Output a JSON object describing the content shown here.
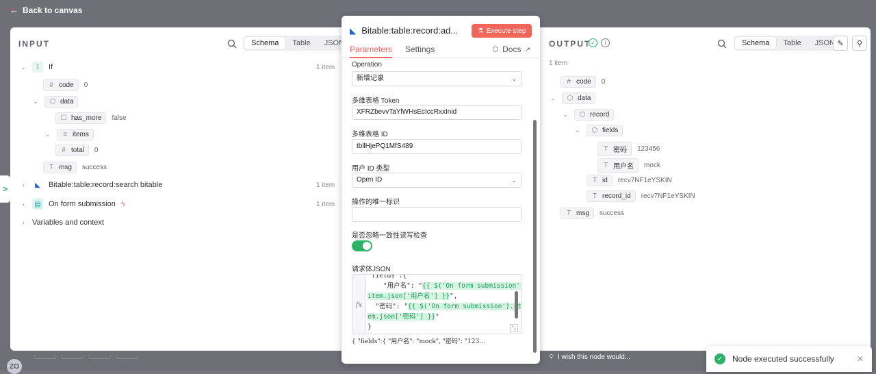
{
  "nav": {
    "back_label": "Back to canvas"
  },
  "input": {
    "title": "INPUT",
    "views": [
      "Schema",
      "Table",
      "JSON"
    ],
    "if_node": {
      "label": "If",
      "count": "1 item"
    },
    "fields": {
      "code": {
        "key": "code",
        "value": "0"
      },
      "data": {
        "key": "data"
      },
      "has_more": {
        "key": "has_more",
        "value": "false"
      },
      "items": {
        "key": "items"
      },
      "total": {
        "key": "total",
        "value": "0"
      },
      "msg": {
        "key": "msg",
        "value": "success"
      }
    },
    "bitable_node": {
      "label": "Bitable:table:record:search bitable",
      "count": "1 item"
    },
    "form_node": {
      "label": "On form submission",
      "count": "1 item"
    },
    "variables_label": "Variables and context"
  },
  "panel": {
    "title": "Bitable:table:record:ad...",
    "execute_label": "Execute step",
    "tabs": [
      "Parameters",
      "Settings"
    ],
    "docs_label": "Docs",
    "operation_label": "Operation",
    "operation_value": "新增记录",
    "token_label": "多维表格 Token",
    "token_value": "XFRZbevvTaYlWHsEcIccRxxInid",
    "table_id_label": "多维表格 ID",
    "table_id_value": "tbllHjePQ1MfS489",
    "user_id_type_label": "用户 ID 类型",
    "user_id_type_value": "Open ID",
    "unique_id_label": "操作的唯一标识",
    "unique_id_value": "",
    "ignore_check_label": "是否忽略一致性读写检查",
    "ignore_check_on": true,
    "body_json_label": "请求体JSON",
    "code_lines": [
      "\"fields\":{",
      "  \"用户名\": \"{{ $('On form submission').",
      "item.json['用户名'] }}\",",
      "  \"密码\": \"{{ $('On form submission').it",
      "em.json['密码'] }}\"",
      "}"
    ],
    "preview": "{ \"fields\":{   \"用户名\":  \"mock\",    \"密码\":  \"123…"
  },
  "output": {
    "title": "OUTPUT",
    "views": [
      "Schema",
      "Table",
      "JSON"
    ],
    "count": "1 item",
    "fields": {
      "code": {
        "key": "code",
        "value": "0"
      },
      "data": {
        "key": "data"
      },
      "record": {
        "key": "record"
      },
      "fields": {
        "key": "fields"
      },
      "password": {
        "key": "密码",
        "value": "123456"
      },
      "username": {
        "key": "用户名",
        "value": "mock"
      },
      "id": {
        "key": "id",
        "value": "recv7NF1eYSKIN"
      },
      "record_id": {
        "key": "record_id",
        "value": "recv7NF1eYSKIN"
      },
      "msg": {
        "key": "msg",
        "value": "success"
      }
    }
  },
  "footer": {
    "wish_label": "I wish this node would...",
    "avatar_initials": "ZO",
    "toast_message": "Node executed successfully"
  },
  "colors": {
    "accent": "#f0665a",
    "success": "#2bb267"
  }
}
